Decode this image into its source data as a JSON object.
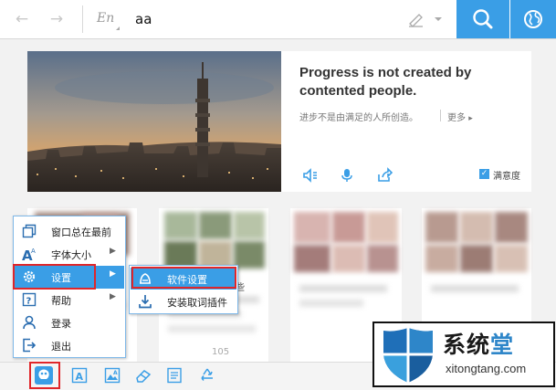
{
  "toolbar": {
    "back_icon": "arrow-left-icon",
    "forward_icon": "arrow-right-icon",
    "lang_label": "En",
    "search_value": "aa",
    "handwrite_icon": "handwriting-icon",
    "search_icon": "search-icon",
    "globe_icon": "globe-icon",
    "accent_color": "#3a9ee6"
  },
  "daily": {
    "quote_en": "Progress is not created by contented people.",
    "quote_cn": "进步不是由满足的人所创造。",
    "more_label": "更多",
    "satisfaction_label": "满意度",
    "satisfaction_checked": true,
    "actions": [
      "speaker-icon",
      "microphone-icon",
      "share-icon"
    ]
  },
  "feed": {
    "card2_text": "些",
    "card2_likes": "105"
  },
  "context_menu": {
    "items": [
      {
        "label": "窗口总在最前",
        "icon": "window-icon",
        "has_submenu": false
      },
      {
        "label": "字体大小",
        "icon": "font-size-icon",
        "has_submenu": true
      },
      {
        "label": "设置",
        "icon": "gear-icon",
        "has_submenu": true,
        "highlighted": true
      },
      {
        "label": "帮助",
        "icon": "help-icon",
        "has_submenu": true
      },
      {
        "label": "登录",
        "icon": "user-icon",
        "has_submenu": false
      },
      {
        "label": "退出",
        "icon": "exit-icon",
        "has_submenu": false
      }
    ],
    "submenu": [
      {
        "label": "软件设置",
        "icon": "settings-bell-icon",
        "highlighted": true
      },
      {
        "label": "安装取词插件",
        "icon": "download-icon",
        "highlighted": false
      }
    ]
  },
  "bottom_bar": {
    "icons": [
      "app-menu-icon",
      "text-icon",
      "image-translate-icon",
      "eraser-icon",
      "translate-doc-icon",
      "recycle-icon"
    ]
  },
  "watermark": {
    "title_main": "系统",
    "title_accent": "堂",
    "url": "xitongtang.com",
    "highlight_color": "#e0262a"
  }
}
